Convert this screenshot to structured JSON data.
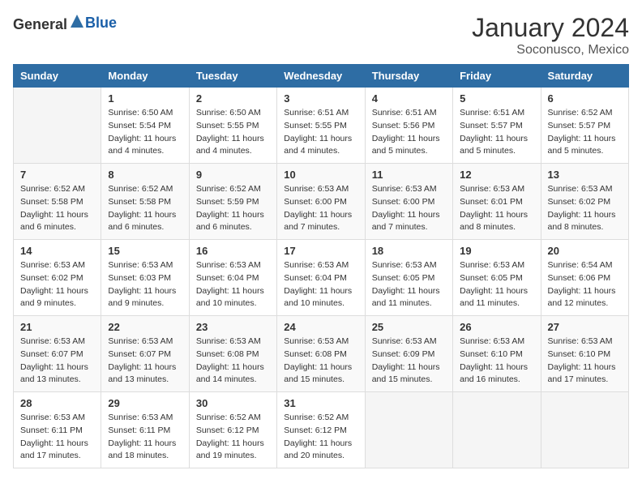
{
  "logo": {
    "general": "General",
    "blue": "Blue"
  },
  "title": "January 2024",
  "subtitle": "Soconusco, Mexico",
  "weekdays": [
    "Sunday",
    "Monday",
    "Tuesday",
    "Wednesday",
    "Thursday",
    "Friday",
    "Saturday"
  ],
  "weeks": [
    [
      {
        "day": "",
        "sunrise": "",
        "sunset": "",
        "daylight": ""
      },
      {
        "day": "1",
        "sunrise": "Sunrise: 6:50 AM",
        "sunset": "Sunset: 5:54 PM",
        "daylight": "Daylight: 11 hours and 4 minutes."
      },
      {
        "day": "2",
        "sunrise": "Sunrise: 6:50 AM",
        "sunset": "Sunset: 5:55 PM",
        "daylight": "Daylight: 11 hours and 4 minutes."
      },
      {
        "day": "3",
        "sunrise": "Sunrise: 6:51 AM",
        "sunset": "Sunset: 5:55 PM",
        "daylight": "Daylight: 11 hours and 4 minutes."
      },
      {
        "day": "4",
        "sunrise": "Sunrise: 6:51 AM",
        "sunset": "Sunset: 5:56 PM",
        "daylight": "Daylight: 11 hours and 5 minutes."
      },
      {
        "day": "5",
        "sunrise": "Sunrise: 6:51 AM",
        "sunset": "Sunset: 5:57 PM",
        "daylight": "Daylight: 11 hours and 5 minutes."
      },
      {
        "day": "6",
        "sunrise": "Sunrise: 6:52 AM",
        "sunset": "Sunset: 5:57 PM",
        "daylight": "Daylight: 11 hours and 5 minutes."
      }
    ],
    [
      {
        "day": "7",
        "sunrise": "Sunrise: 6:52 AM",
        "sunset": "Sunset: 5:58 PM",
        "daylight": "Daylight: 11 hours and 6 minutes."
      },
      {
        "day": "8",
        "sunrise": "Sunrise: 6:52 AM",
        "sunset": "Sunset: 5:58 PM",
        "daylight": "Daylight: 11 hours and 6 minutes."
      },
      {
        "day": "9",
        "sunrise": "Sunrise: 6:52 AM",
        "sunset": "Sunset: 5:59 PM",
        "daylight": "Daylight: 11 hours and 6 minutes."
      },
      {
        "day": "10",
        "sunrise": "Sunrise: 6:53 AM",
        "sunset": "Sunset: 6:00 PM",
        "daylight": "Daylight: 11 hours and 7 minutes."
      },
      {
        "day": "11",
        "sunrise": "Sunrise: 6:53 AM",
        "sunset": "Sunset: 6:00 PM",
        "daylight": "Daylight: 11 hours and 7 minutes."
      },
      {
        "day": "12",
        "sunrise": "Sunrise: 6:53 AM",
        "sunset": "Sunset: 6:01 PM",
        "daylight": "Daylight: 11 hours and 8 minutes."
      },
      {
        "day": "13",
        "sunrise": "Sunrise: 6:53 AM",
        "sunset": "Sunset: 6:02 PM",
        "daylight": "Daylight: 11 hours and 8 minutes."
      }
    ],
    [
      {
        "day": "14",
        "sunrise": "Sunrise: 6:53 AM",
        "sunset": "Sunset: 6:02 PM",
        "daylight": "Daylight: 11 hours and 9 minutes."
      },
      {
        "day": "15",
        "sunrise": "Sunrise: 6:53 AM",
        "sunset": "Sunset: 6:03 PM",
        "daylight": "Daylight: 11 hours and 9 minutes."
      },
      {
        "day": "16",
        "sunrise": "Sunrise: 6:53 AM",
        "sunset": "Sunset: 6:04 PM",
        "daylight": "Daylight: 11 hours and 10 minutes."
      },
      {
        "day": "17",
        "sunrise": "Sunrise: 6:53 AM",
        "sunset": "Sunset: 6:04 PM",
        "daylight": "Daylight: 11 hours and 10 minutes."
      },
      {
        "day": "18",
        "sunrise": "Sunrise: 6:53 AM",
        "sunset": "Sunset: 6:05 PM",
        "daylight": "Daylight: 11 hours and 11 minutes."
      },
      {
        "day": "19",
        "sunrise": "Sunrise: 6:53 AM",
        "sunset": "Sunset: 6:05 PM",
        "daylight": "Daylight: 11 hours and 11 minutes."
      },
      {
        "day": "20",
        "sunrise": "Sunrise: 6:54 AM",
        "sunset": "Sunset: 6:06 PM",
        "daylight": "Daylight: 11 hours and 12 minutes."
      }
    ],
    [
      {
        "day": "21",
        "sunrise": "Sunrise: 6:53 AM",
        "sunset": "Sunset: 6:07 PM",
        "daylight": "Daylight: 11 hours and 13 minutes."
      },
      {
        "day": "22",
        "sunrise": "Sunrise: 6:53 AM",
        "sunset": "Sunset: 6:07 PM",
        "daylight": "Daylight: 11 hours and 13 minutes."
      },
      {
        "day": "23",
        "sunrise": "Sunrise: 6:53 AM",
        "sunset": "Sunset: 6:08 PM",
        "daylight": "Daylight: 11 hours and 14 minutes."
      },
      {
        "day": "24",
        "sunrise": "Sunrise: 6:53 AM",
        "sunset": "Sunset: 6:08 PM",
        "daylight": "Daylight: 11 hours and 15 minutes."
      },
      {
        "day": "25",
        "sunrise": "Sunrise: 6:53 AM",
        "sunset": "Sunset: 6:09 PM",
        "daylight": "Daylight: 11 hours and 15 minutes."
      },
      {
        "day": "26",
        "sunrise": "Sunrise: 6:53 AM",
        "sunset": "Sunset: 6:10 PM",
        "daylight": "Daylight: 11 hours and 16 minutes."
      },
      {
        "day": "27",
        "sunrise": "Sunrise: 6:53 AM",
        "sunset": "Sunset: 6:10 PM",
        "daylight": "Daylight: 11 hours and 17 minutes."
      }
    ],
    [
      {
        "day": "28",
        "sunrise": "Sunrise: 6:53 AM",
        "sunset": "Sunset: 6:11 PM",
        "daylight": "Daylight: 11 hours and 17 minutes."
      },
      {
        "day": "29",
        "sunrise": "Sunrise: 6:53 AM",
        "sunset": "Sunset: 6:11 PM",
        "daylight": "Daylight: 11 hours and 18 minutes."
      },
      {
        "day": "30",
        "sunrise": "Sunrise: 6:52 AM",
        "sunset": "Sunset: 6:12 PM",
        "daylight": "Daylight: 11 hours and 19 minutes."
      },
      {
        "day": "31",
        "sunrise": "Sunrise: 6:52 AM",
        "sunset": "Sunset: 6:12 PM",
        "daylight": "Daylight: 11 hours and 20 minutes."
      },
      {
        "day": "",
        "sunrise": "",
        "sunset": "",
        "daylight": ""
      },
      {
        "day": "",
        "sunrise": "",
        "sunset": "",
        "daylight": ""
      },
      {
        "day": "",
        "sunrise": "",
        "sunset": "",
        "daylight": ""
      }
    ]
  ]
}
